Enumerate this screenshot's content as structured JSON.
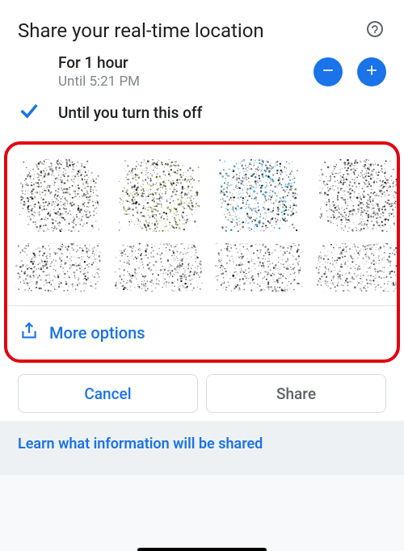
{
  "header": {
    "title": "Share your real-time location"
  },
  "duration_option": {
    "label": "For 1 hour",
    "sub": "Until 5:21 PM"
  },
  "turnoff_option": {
    "label": "Until you turn this off"
  },
  "more_options_label": "More options",
  "buttons": {
    "cancel": "Cancel",
    "share": "Share"
  },
  "footer_link": "Learn what information will be shared",
  "contacts": [
    {
      "avatar_color": "#4d4136"
    },
    {
      "avatar_color": "#7a8f2e"
    },
    {
      "avatar_color": "#1e9bde"
    },
    {
      "avatar_color": "#3a3a3a"
    }
  ],
  "colors": {
    "primary": "#1a73e8",
    "highlight_border": "#e3000f"
  }
}
